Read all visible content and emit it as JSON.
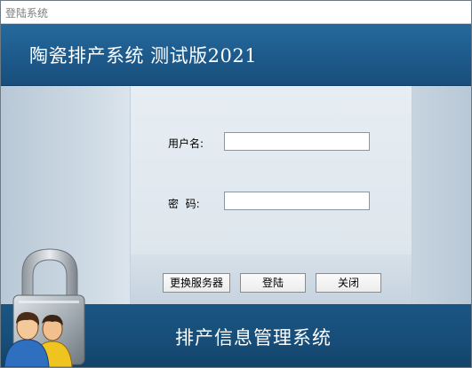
{
  "window": {
    "title": "登陆系统"
  },
  "header": {
    "title": "陶瓷排产系统 测试版2021"
  },
  "form": {
    "username_label": "用户名:",
    "username_value": "",
    "password_label": "密  码:",
    "password_value": ""
  },
  "buttons": {
    "server_label": "更换服务器",
    "login_label": "登陆",
    "close_label": "关闭"
  },
  "footer": {
    "title": "排产信息管理系统"
  },
  "icons": {
    "lock": "padlock-icon",
    "users": "users-icon"
  }
}
